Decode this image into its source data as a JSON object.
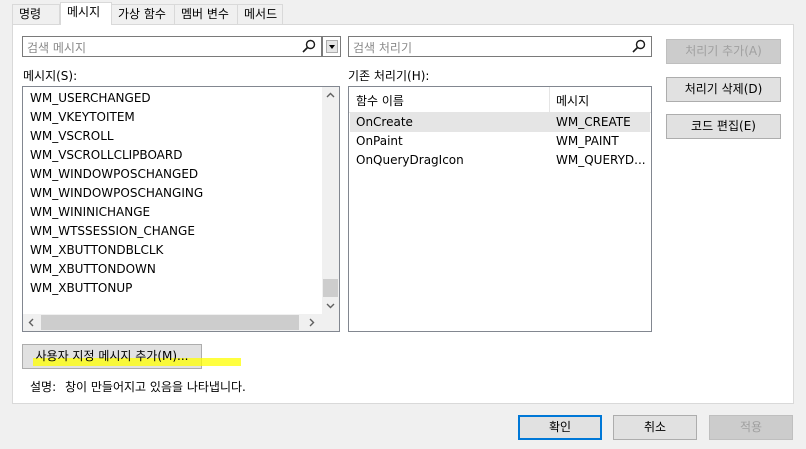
{
  "tabs": [
    {
      "label": "명령"
    },
    {
      "label": "메시지"
    },
    {
      "label": "가상 함수"
    },
    {
      "label": "멤버 변수"
    },
    {
      "label": "메서드"
    }
  ],
  "message_search": {
    "placeholder": "검색 메시지"
  },
  "handler_search": {
    "placeholder": "검색 처리기"
  },
  "messages_label": "메시지(S):",
  "handlers_label": "기존 처리기(H):",
  "messages": [
    "WM_USERCHANGED",
    "WM_VKEYTOITEM",
    "WM_VSCROLL",
    "WM_VSCROLLCLIPBOARD",
    "WM_WINDOWPOSCHANGED",
    "WM_WINDOWPOSCHANGING",
    "WM_WININICHANGE",
    "WM_WTSSESSION_CHANGE",
    "WM_XBUTTONDBLCLK",
    "WM_XBUTTONDOWN",
    "WM_XBUTTONUP"
  ],
  "handlers_table": {
    "columns": [
      "함수 이름",
      "메시지"
    ],
    "rows": [
      {
        "function": "OnCreate",
        "message": "WM_CREATE"
      },
      {
        "function": "OnPaint",
        "message": "WM_PAINT"
      },
      {
        "function": "OnQueryDragIcon",
        "message": "WM_QUERYD..."
      }
    ]
  },
  "side_buttons": {
    "add": "처리기 추가(A)",
    "delete": "처리기 삭제(D)",
    "edit": "코드 편집(E)"
  },
  "custom_message_button": "사용자 지정 메시지 추가(M)...",
  "description": {
    "label": "설명:",
    "text": "창이 만들어지고 있음을 나타냅니다."
  },
  "footer_buttons": {
    "ok": "확인",
    "cancel": "취소",
    "apply": "적용"
  },
  "colors": {
    "selection": "#e5e5e5",
    "accent_border": "#0078d7",
    "highlight": "#ffff00"
  },
  "icons": {
    "search": "search-icon",
    "dropdown": "chevron-down-icon"
  }
}
